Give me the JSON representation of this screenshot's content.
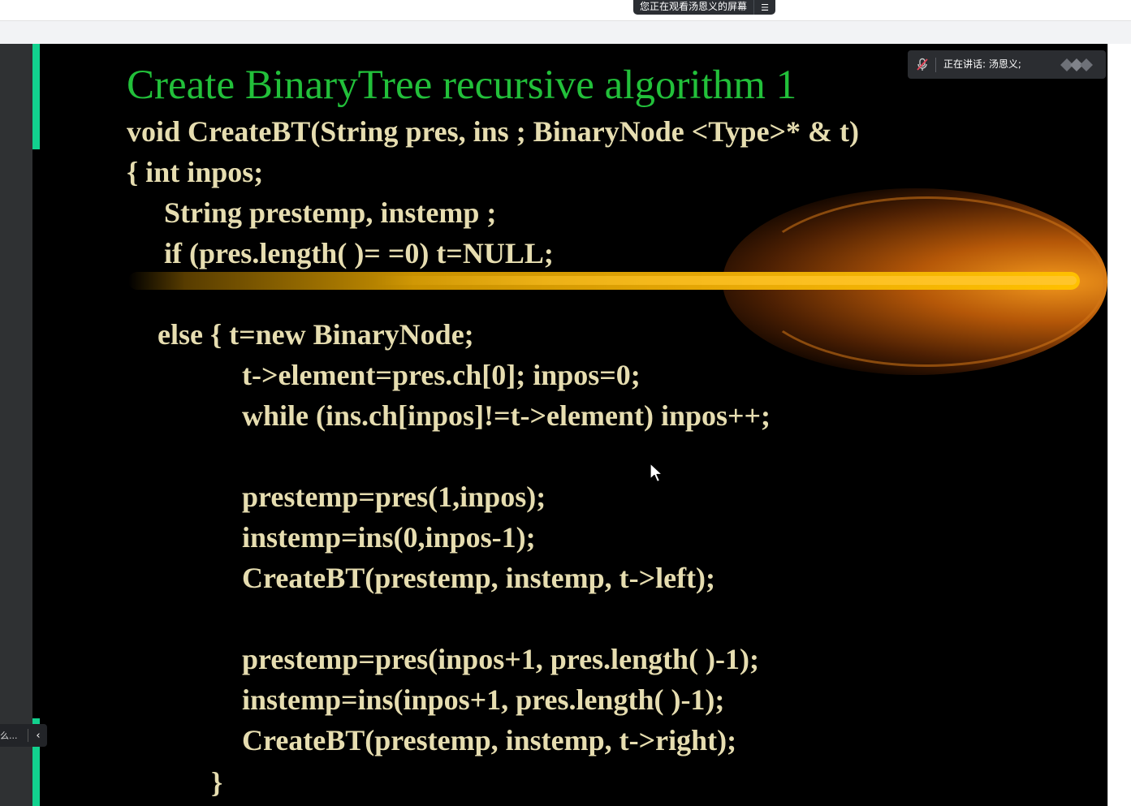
{
  "screen_share": {
    "banner_text": "您正在观看汤恩义的屏幕",
    "menu_icon": "menu-lines-icon"
  },
  "speaker": {
    "label": "正在讲话: 汤恩义;",
    "mic_icon": "mic-muted-icon",
    "wave_icon": "sound-wave-icon"
  },
  "slide": {
    "title": "Create BinaryTree recursive algorithm 1",
    "code_lines": [
      "void CreateBT(String  pres,  ins ;  BinaryNode <Type>*  & t)",
      "{    int inpos;",
      "String   prestemp,  instemp ;",
      "if (pres.length( )= =0)  t=NULL;",
      "else {   t=new  BinaryNode;",
      "t->element=pres.ch[0];      inpos=0;",
      "while  (ins.ch[inpos]!=t->element)  inpos++;",
      "prestemp=pres(1,inpos);",
      "instemp=ins(0,inpos-1);",
      "CreateBT(prestemp,  instemp,  t->left);",
      "prestemp=pres(inpos+1,  pres.length( )-1);",
      "instemp=ins(inpos+1,  pres.length( )-1);",
      "CreateBT(prestemp,  instemp,  t->right);",
      "}"
    ],
    "colors": {
      "title": "#22c03a",
      "code": "#e6ddb0",
      "background": "#000000",
      "streak": "#ffc000",
      "accent": "#12d18e"
    }
  },
  "dock": {
    "label": "么...",
    "collapse_icon": "chevron-left-icon"
  }
}
